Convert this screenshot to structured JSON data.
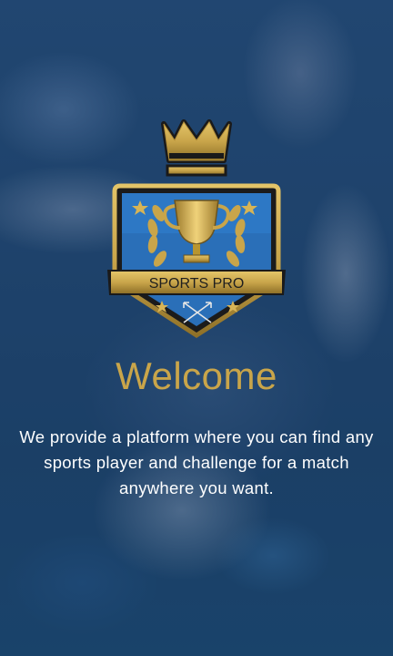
{
  "logo": {
    "text": "SPORTS PRO",
    "icon": "trophy-crown-shield-icon"
  },
  "welcome": {
    "title": "Welcome",
    "description": "We provide a platform where you can find any sports player and challenge for a match anywhere you want."
  },
  "colors": {
    "gold": "#c9a54a",
    "background": "#1f4468",
    "text": "#ffffff"
  }
}
